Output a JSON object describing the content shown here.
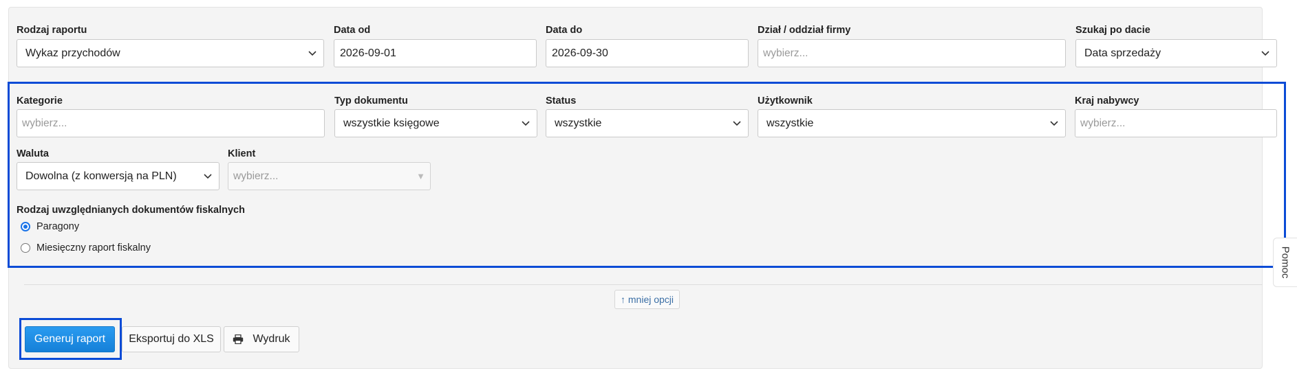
{
  "row1": {
    "report_type": {
      "label": "Rodzaj raportu",
      "value": "Wykaz przychodów"
    },
    "date_from": {
      "label": "Data od",
      "value": "2026-09-01"
    },
    "date_to": {
      "label": "Data do",
      "value": "2026-09-30"
    },
    "department": {
      "label": "Dział / oddział firmy",
      "placeholder": "wybierz..."
    },
    "search_by_date": {
      "label": "Szukaj po dacie",
      "value": "Data sprzedaży"
    }
  },
  "row2": {
    "categories": {
      "label": "Kategorie",
      "placeholder": "wybierz..."
    },
    "document_type": {
      "label": "Typ dokumentu",
      "value": "wszystkie księgowe"
    },
    "status": {
      "label": "Status",
      "value": "wszystkie"
    },
    "user": {
      "label": "Użytkownik",
      "value": "wszystkie"
    },
    "buyer_country": {
      "label": "Kraj nabywcy",
      "placeholder": "wybierz..."
    }
  },
  "row3": {
    "currency": {
      "label": "Waluta",
      "value": "Dowolna (z konwersją na PLN)"
    },
    "client": {
      "label": "Klient",
      "placeholder": "wybierz..."
    }
  },
  "fiscal": {
    "label": "Rodzaj uwzględnianych dokumentów fiskalnych",
    "options": [
      {
        "label": "Paragony",
        "checked": true
      },
      {
        "label": "Miesięczny raport fiskalny",
        "checked": false
      }
    ]
  },
  "less_options": "↑ mniej opcji",
  "buttons": {
    "generate": "Generuj raport",
    "export_xls": "Eksportuj do XLS",
    "print": "Wydruk"
  },
  "side_tab": "Pomoc",
  "colors": {
    "highlight": "#0a4bd6",
    "primary": "#1b8fe6"
  },
  "icons": {
    "select": "chevron-down-icon",
    "print": "printer-icon",
    "autocomplete": "triangle-down-icon"
  }
}
